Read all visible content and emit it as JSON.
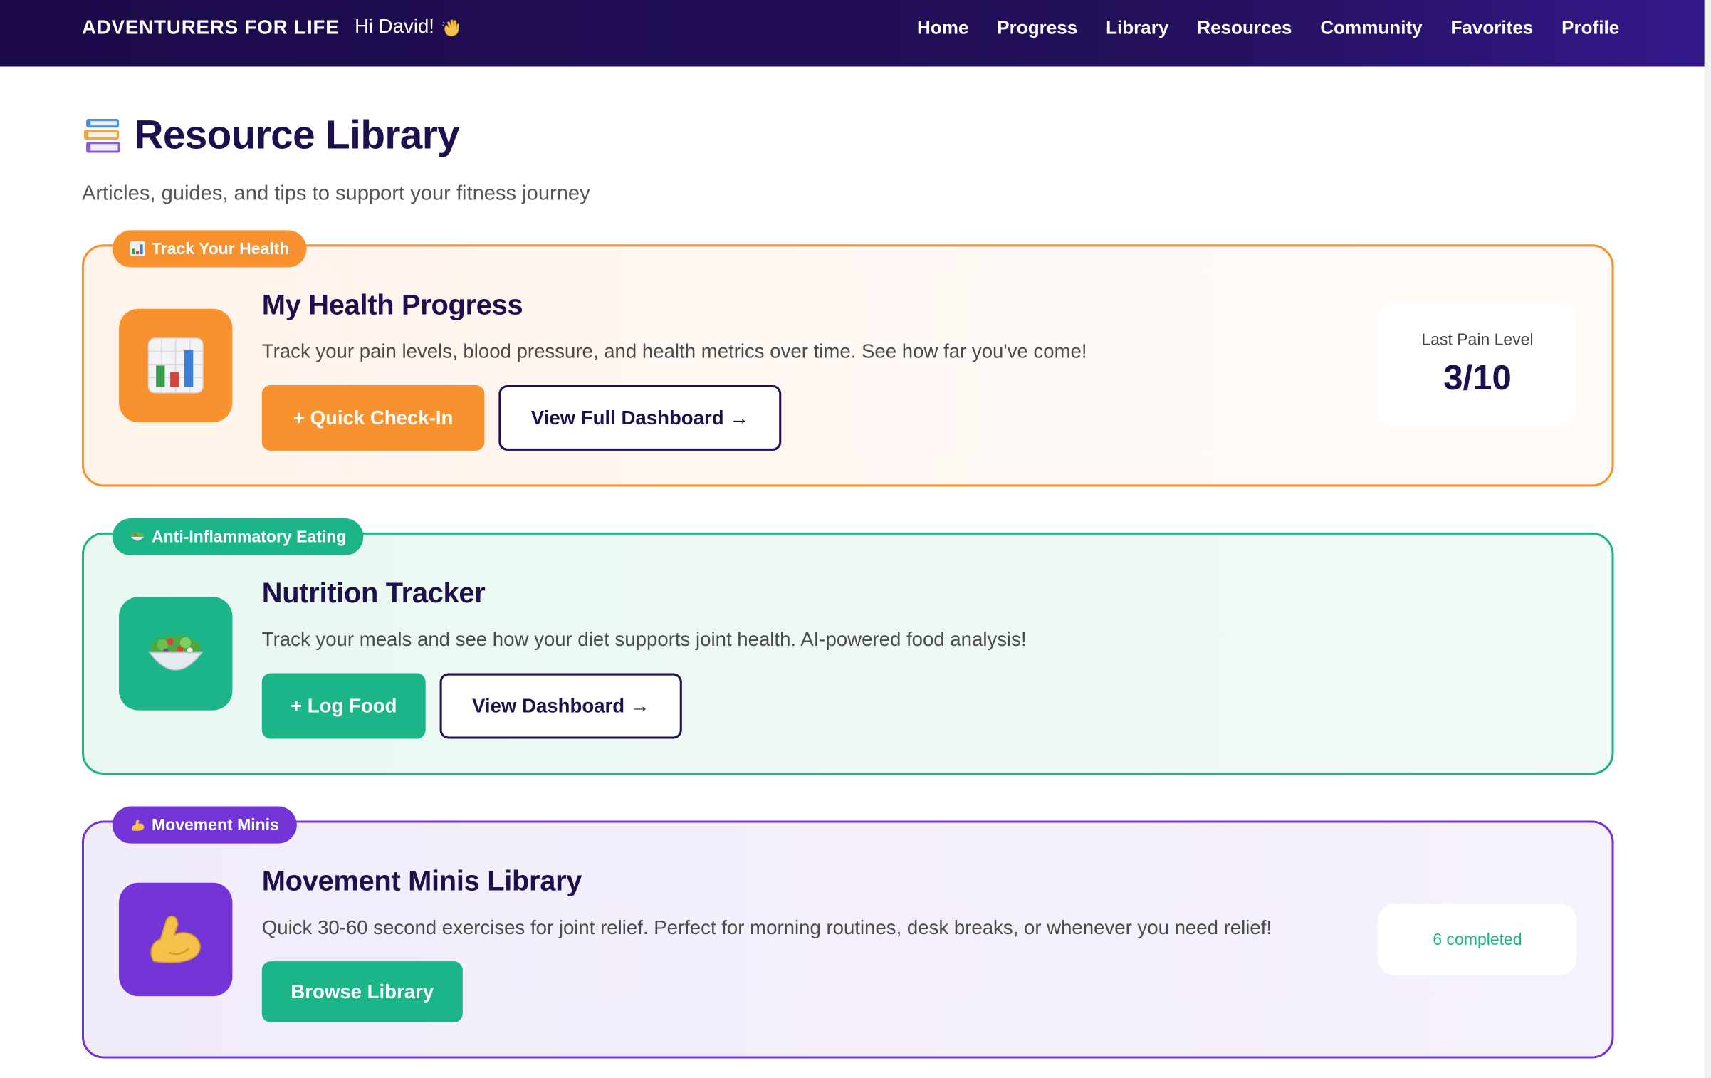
{
  "header": {
    "brand": "ADVENTURERS FOR LIFE",
    "greeting": "Hi David!",
    "nav": [
      "Home",
      "Progress",
      "Library",
      "Resources",
      "Community",
      "Favorites",
      "Profile"
    ]
  },
  "page": {
    "title": "Resource Library",
    "subtitle": "Articles, guides, and tips to support your fitness journey"
  },
  "cards": {
    "health": {
      "tag": "Track Your Health",
      "title": "My Health Progress",
      "description": "Track your pain levels, blood pressure, and health metrics over time. See how far you've come!",
      "primary_button": "+ Quick Check-In",
      "secondary_button": "View Full Dashboard →",
      "stat_label": "Last Pain Level",
      "stat_value": "3/10"
    },
    "nutrition": {
      "tag": "Anti-Inflammatory Eating",
      "title": "Nutrition Tracker",
      "description": "Track your meals and see how your diet supports joint health. AI-powered food analysis!",
      "primary_button": "+ Log Food",
      "secondary_button": "View Dashboard →"
    },
    "movement": {
      "tag": "Movement Minis",
      "title": "Movement Minis Library",
      "description": "Quick 30-60 second exercises for joint relief. Perfect for morning routines, desk breaks, or whenever you need relief!",
      "primary_button": "Browse Library",
      "completed": "6 completed"
    }
  },
  "colors": {
    "header_bg": "#1c0a4a",
    "orange": "#f7922e",
    "green": "#1cb58a",
    "purple": "#7435d8",
    "title": "#1e0f4f"
  },
  "icons": [
    "waving-hand-icon",
    "books-icon",
    "bar-chart-icon",
    "salad-icon",
    "flexed-biceps-icon"
  ]
}
